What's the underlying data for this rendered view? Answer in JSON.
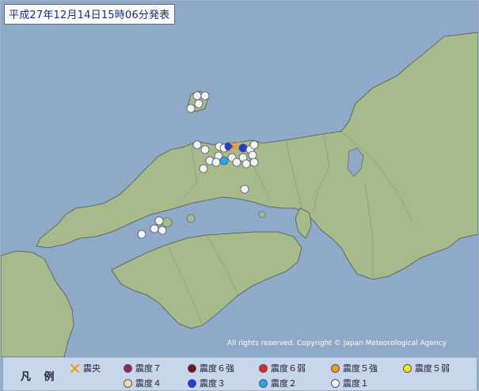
{
  "header": {
    "title": "平成27年12月14日15時06分発表"
  },
  "map": {
    "copyright": "All rights reserved. Copyright © Japan Meteorological Agency",
    "colors": {
      "sea": "#8fa9c9",
      "land": "#a6ba8b",
      "coast": "#4e5c46"
    }
  },
  "legend": {
    "title": "凡 例",
    "items": [
      {
        "label": "震央",
        "icon": "epicenter-x-icon",
        "color": "#f29a1e"
      },
      {
        "label": "震度７",
        "icon": "intensity-7-dot",
        "color": "#9b1f6a"
      },
      {
        "label": "震度６強",
        "icon": "intensity-6-upper-dot",
        "color": "#7a0e1a"
      },
      {
        "label": "震度６弱",
        "icon": "intensity-6-lower-dot",
        "color": "#e3271b"
      },
      {
        "label": "震度５強",
        "icon": "intensity-5-upper-dot",
        "color": "#f29a1e"
      },
      {
        "label": "震度５弱",
        "icon": "intensity-5-lower-dot",
        "color": "#f1e418"
      },
      {
        "label": "震度４",
        "icon": "intensity-4-dot",
        "color": "#f3dc9c"
      },
      {
        "label": "震度３",
        "icon": "intensity-3-dot",
        "color": "#1a3fe0"
      },
      {
        "label": "震度２",
        "icon": "intensity-2-dot",
        "color": "#27a4ec"
      },
      {
        "label": "震度１",
        "icon": "intensity-1-dot",
        "color": "#f4f4f4"
      }
    ]
  }
}
